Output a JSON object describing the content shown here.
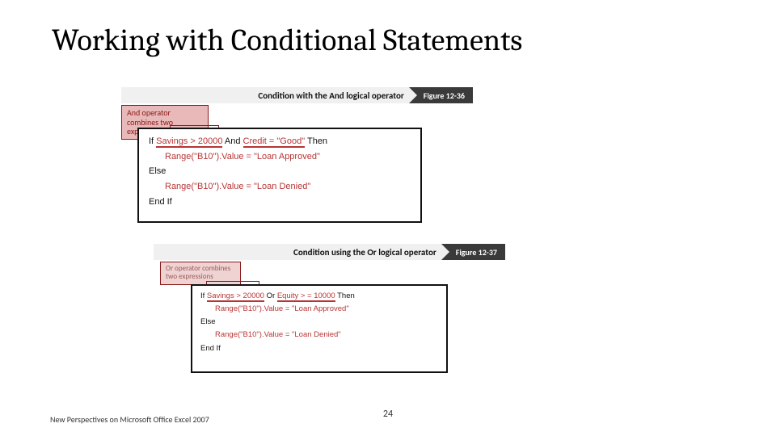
{
  "title": "Working with Conditional Statements",
  "figure1": {
    "caption": "Condition with the And logical operator",
    "tag": "Figure 12-36",
    "callout": "And operator combines two expressions",
    "code": {
      "l1a": "If ",
      "l1b": "Savings > 20000",
      "l1c": " And ",
      "l1d": "Credit = \"Good\"",
      "l1e": " Then",
      "l2": "Range(\"B10\").Value = \"Loan Approved\"",
      "l3": "Else",
      "l4": "Range(\"B10\").Value = \"Loan Denied\"",
      "l5": "End If"
    }
  },
  "figure2": {
    "caption": "Condition using the Or logical operator",
    "tag": "Figure  12-37",
    "callout": "Or operator combines two expressions",
    "code": {
      "l1a": "If ",
      "l1b": "Savings > 20000",
      "l1c": " Or ",
      "l1d": "Equity > = 10000",
      "l1e": " Then",
      "l2": "Range(\"B10\").Value = \"Loan Approved\"",
      "l3": "Else",
      "l4": "Range(\"B10\").Value = \"Loan Denied\"",
      "l5": "End If"
    }
  },
  "footer": {
    "source": "New Perspectives on Microsoft Office Excel 2007",
    "page": "24"
  }
}
